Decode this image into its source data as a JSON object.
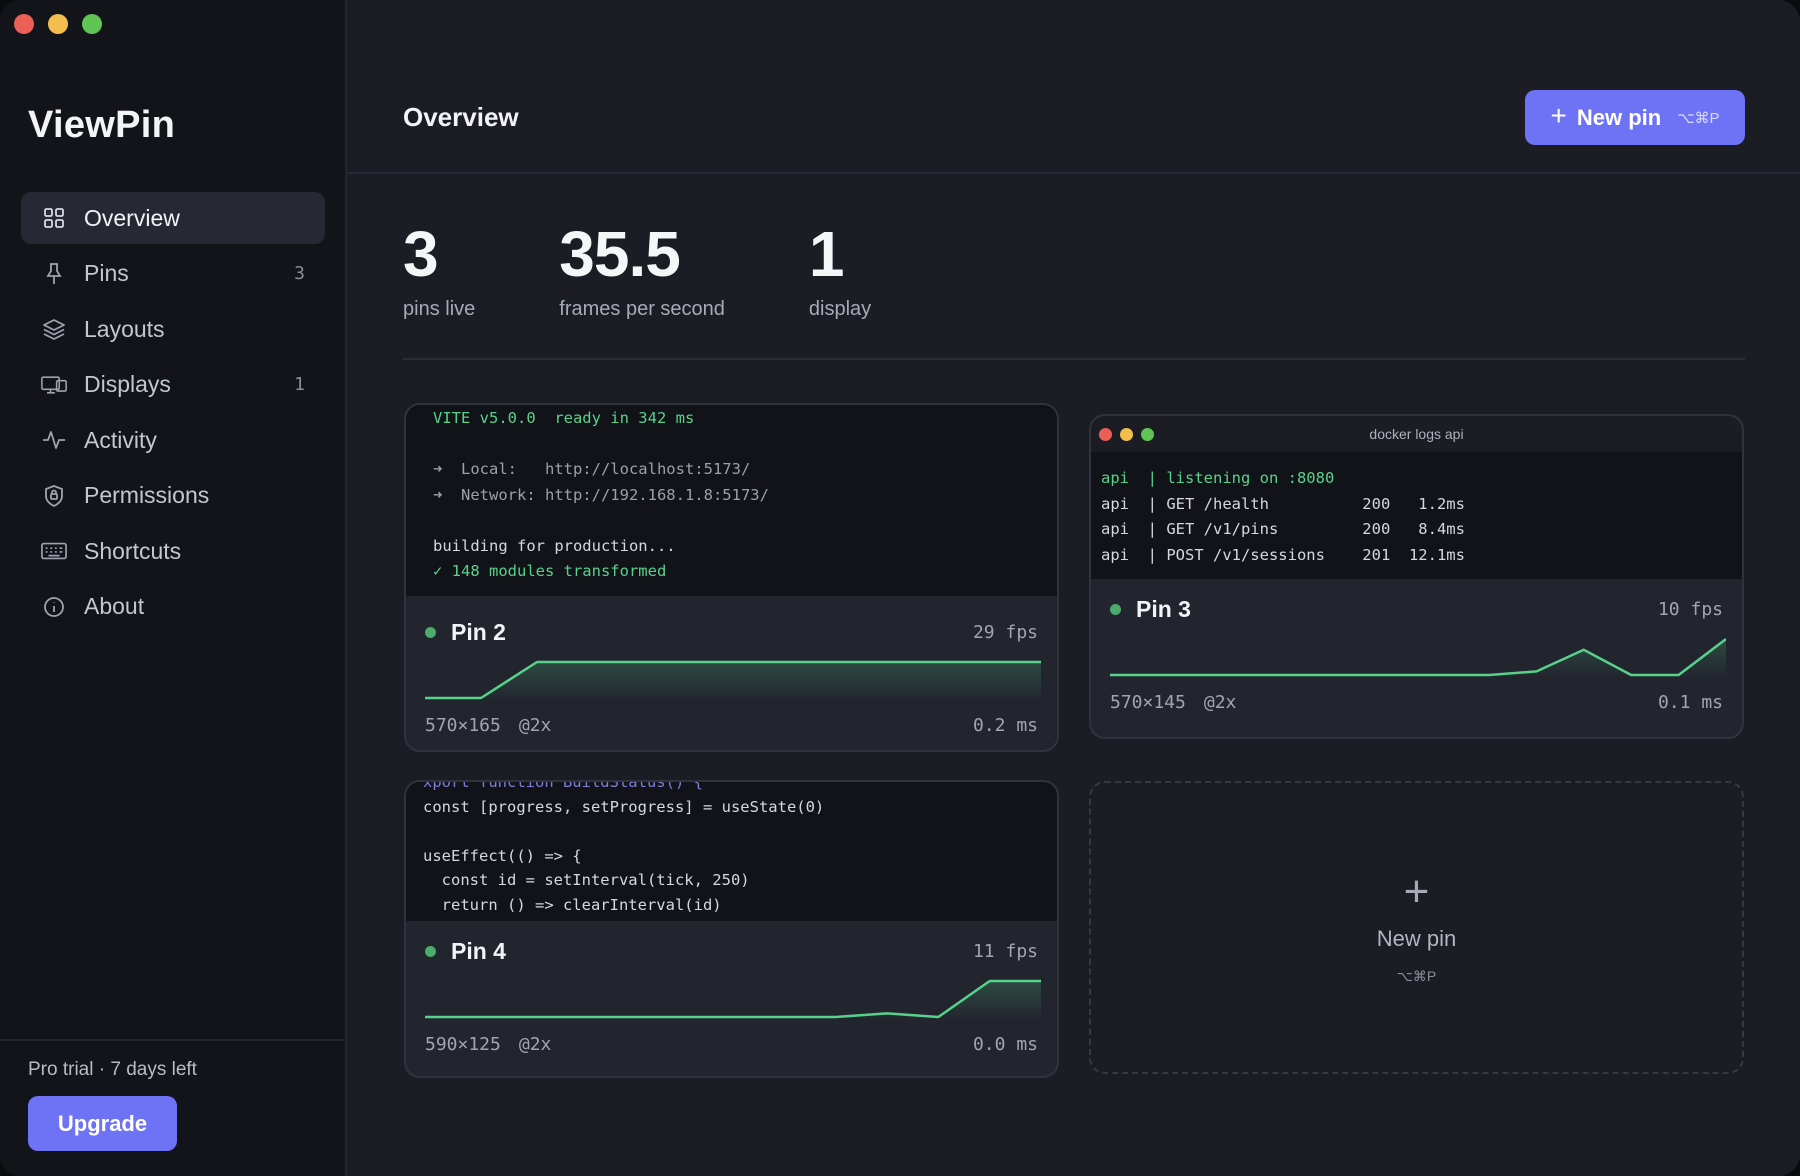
{
  "app": {
    "name": "ViewPin"
  },
  "sidebar": {
    "items": [
      {
        "label": "Overview",
        "icon": "grid-icon",
        "count": ""
      },
      {
        "label": "Pins",
        "icon": "pin-icon",
        "count": "3"
      },
      {
        "label": "Layouts",
        "icon": "layers-icon",
        "count": ""
      },
      {
        "label": "Displays",
        "icon": "display-icon",
        "count": "1"
      },
      {
        "label": "Activity",
        "icon": "activity-icon",
        "count": ""
      },
      {
        "label": "Permissions",
        "icon": "shield-icon",
        "count": ""
      },
      {
        "label": "Shortcuts",
        "icon": "keyboard-icon",
        "count": ""
      },
      {
        "label": "About",
        "icon": "info-icon",
        "count": ""
      }
    ],
    "trial_text": "Pro trial · 7 days left",
    "upgrade_label": "Upgrade"
  },
  "header": {
    "title": "Overview",
    "new_pin_label": "New pin",
    "new_pin_shortcut": "⌥⌘P"
  },
  "stats": [
    {
      "value": "3",
      "label": "pins live"
    },
    {
      "value": "35.5",
      "label": "frames per second"
    },
    {
      "value": "1",
      "label": "display"
    }
  ],
  "pins": {
    "pin2": {
      "name": "Pin 2",
      "fps": "29 fps",
      "size": "570×165",
      "scale": "@2x",
      "latency": "0.2 ms",
      "terminal": [
        "VITE v5.0.0  ready in 342 ms",
        "",
        "➜  Local:   http://localhost:5173/",
        "➜  Network: http://192.168.1.8:5173/",
        "",
        "building for production...",
        "✓ 148 modules transformed"
      ],
      "spark": [
        0,
        0,
        1,
        1,
        1,
        1,
        1,
        1,
        1,
        1,
        1,
        1
      ]
    },
    "pin3": {
      "name": "Pin 3",
      "fps": "10 fps",
      "size": "570×145",
      "scale": "@2x",
      "latency": "0.1 ms",
      "window_title": "docker logs api",
      "terminal": [
        "api  | listening on :8080",
        "api  | GET /health          200   1.2ms",
        "api  | GET /v1/pins         200   8.4ms",
        "api  | POST /v1/sessions    201  12.1ms"
      ],
      "spark": [
        0,
        0,
        0,
        0,
        0,
        0,
        0,
        0,
        0,
        0.1,
        0.7,
        0,
        0,
        1
      ]
    },
    "pin4": {
      "name": "Pin 4",
      "fps": "11 fps",
      "size": "590×125",
      "scale": "@2x",
      "latency": "0.0 ms",
      "terminal": [
        "xport function BuildStatus() {",
        "const [progress, setProgress] = useState(0)",
        "",
        "useEffect(() => {",
        "  const id = setInterval(tick, 250)",
        "  return () => clearInterval(id)"
      ],
      "spark": [
        0,
        0,
        0,
        0,
        0,
        0,
        0,
        0,
        0,
        0.1,
        0,
        1,
        1
      ]
    },
    "empty": {
      "label": "New pin",
      "shortcut": "⌥⌘P"
    }
  },
  "colors": {
    "accent": "#6e72f5",
    "live": "#4caa6b",
    "spark": "#58d28a"
  }
}
